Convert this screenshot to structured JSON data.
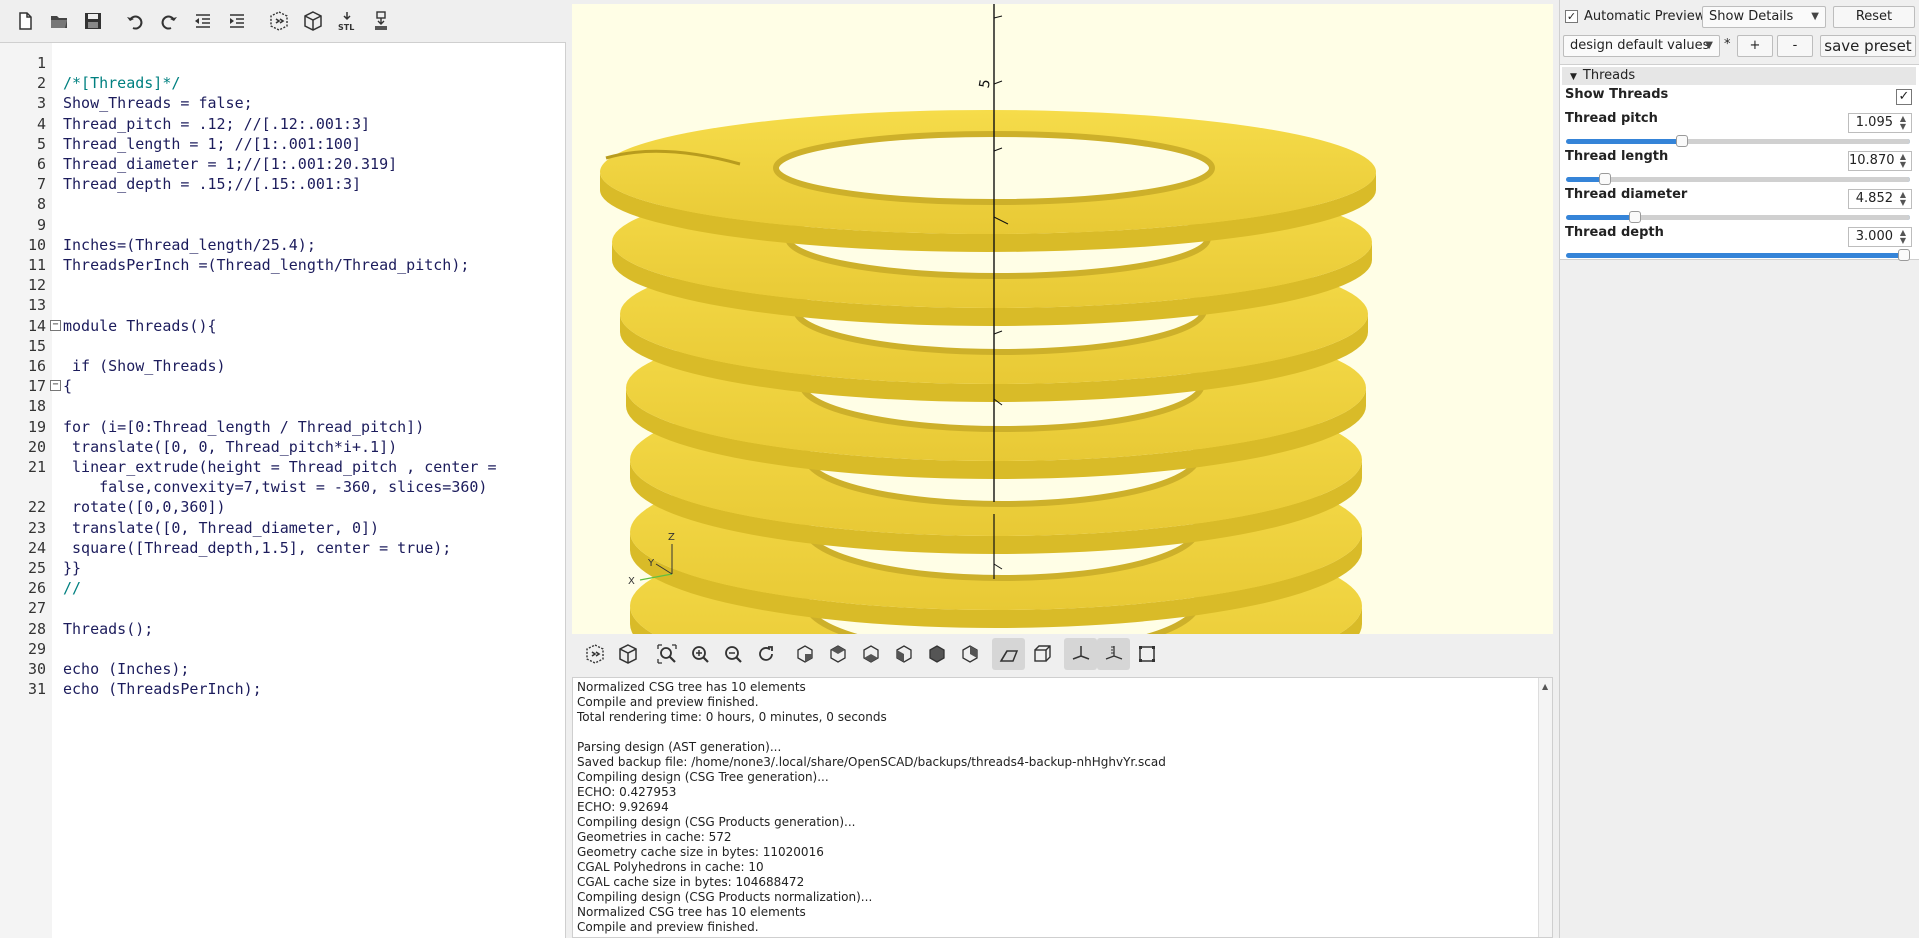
{
  "toolbar": {
    "icons": [
      "new-file-icon",
      "open-file-icon",
      "save-icon",
      "undo-icon",
      "redo-icon",
      "unindent-icon",
      "indent-icon",
      "preview-icon",
      "render-icon",
      "export-stl-icon",
      "send-to-print-icon"
    ],
    "stl_label": "STL"
  },
  "editor": {
    "lines": [
      {
        "n": "1",
        "code": ""
      },
      {
        "n": "2",
        "code": "/*[Threads]*/"
      },
      {
        "n": "3",
        "code": "Show_Threads = false;"
      },
      {
        "n": "4",
        "code": "Thread_pitch = .12; //[.12:.001:3]"
      },
      {
        "n": "5",
        "code": "Thread_length = 1; //[1:.001:100]"
      },
      {
        "n": "6",
        "code": "Thread_diameter = 1;//[1:.001:20.319]"
      },
      {
        "n": "7",
        "code": "Thread_depth = .15;//[.15:.001:3]"
      },
      {
        "n": "8",
        "code": ""
      },
      {
        "n": "9",
        "code": ""
      },
      {
        "n": "10",
        "code": "Inches=(Thread_length/25.4);"
      },
      {
        "n": "11",
        "code": "ThreadsPerInch =(Thread_length/Thread_pitch);"
      },
      {
        "n": "12",
        "code": ""
      },
      {
        "n": "13",
        "code": ""
      },
      {
        "n": "14",
        "code": "module Threads(){"
      },
      {
        "n": "15",
        "code": ""
      },
      {
        "n": "16",
        "code": " if (Show_Threads)"
      },
      {
        "n": "17",
        "code": "{"
      },
      {
        "n": "18",
        "code": ""
      },
      {
        "n": "19",
        "code": "for (i=[0:Thread_length / Thread_pitch])"
      },
      {
        "n": "20",
        "code": " translate([0, 0, Thread_pitch*i+.1])"
      },
      {
        "n": "21",
        "code": " linear_extrude(height = Thread_pitch , center ="
      },
      {
        "n": "",
        "code": "    false,convexity=7,twist = -360, slices=360)"
      },
      {
        "n": "22",
        "code": " rotate([0,0,360])"
      },
      {
        "n": "23",
        "code": " translate([0, Thread_diameter, 0])"
      },
      {
        "n": "24",
        "code": " square([Thread_depth,1.5], center = true);"
      },
      {
        "n": "25",
        "code": "}}"
      },
      {
        "n": "26",
        "code": "//"
      },
      {
        "n": "27",
        "code": ""
      },
      {
        "n": "28",
        "code": "Threads();"
      },
      {
        "n": "29",
        "code": ""
      },
      {
        "n": "30",
        "code": "echo (Inches);"
      },
      {
        "n": "31",
        "code": "echo (ThreadsPerInch);"
      }
    ]
  },
  "viewport": {
    "background": "#fffee6",
    "model_color": "#f2d43a",
    "axis_labels": {
      "z": "Z",
      "x": "X",
      "y": "Y"
    }
  },
  "view_toolbar": {
    "icons": [
      "preview-icon",
      "render-icon",
      "view-all-icon",
      "zoom-in-icon",
      "zoom-out-icon",
      "reset-view-icon",
      "view-right-icon",
      "view-top-icon",
      "view-bottom-icon",
      "view-left-icon",
      "view-front-icon",
      "view-back-icon",
      "perspective-icon",
      "orthogonal-icon",
      "show-axes-icon",
      "show-scale-icon",
      "show-edges-icon"
    ]
  },
  "console": {
    "lines": [
      "Normalized CSG tree has 10 elements",
      "Compile and preview finished.",
      "Total rendering time: 0 hours, 0 minutes, 0 seconds",
      "",
      "Parsing design (AST generation)...",
      "Saved backup file: /home/none3/.local/share/OpenSCAD/backups/threads4-backup-nhHghvYr.scad",
      "Compiling design (CSG Tree generation)...",
      "ECHO: 0.427953",
      "ECHO: 9.92694",
      "Compiling design (CSG Products generation)...",
      "Geometries in cache: 572",
      "Geometry cache size in bytes: 11020016",
      "CGAL Polyhedrons in cache: 10",
      "CGAL cache size in bytes: 104688472",
      "Compiling design (CSG Products normalization)...",
      "Normalized CSG tree has 10 elements",
      "Compile and preview finished."
    ]
  },
  "customizer": {
    "auto_preview_label": "Automatic Preview",
    "auto_preview_checked": true,
    "show_details": "Show Details",
    "reset_label": "Reset",
    "preset": "design default values",
    "preset_modified": "*",
    "add_label": "+",
    "remove_label": "-",
    "save_preset_label": "save preset",
    "group_label": "Threads",
    "params": {
      "show_threads": {
        "label": "Show Threads",
        "checked": true
      },
      "pitch": {
        "label": "Thread pitch",
        "value": "1.095",
        "fraction": 0.33
      },
      "length": {
        "label": "Thread length",
        "value": "10.870",
        "fraction": 0.1
      },
      "diameter": {
        "label": "Thread diameter",
        "value": "4.852",
        "fraction": 0.19
      },
      "depth": {
        "label": "Thread depth",
        "value": "3.000",
        "fraction": 1.0
      }
    }
  }
}
